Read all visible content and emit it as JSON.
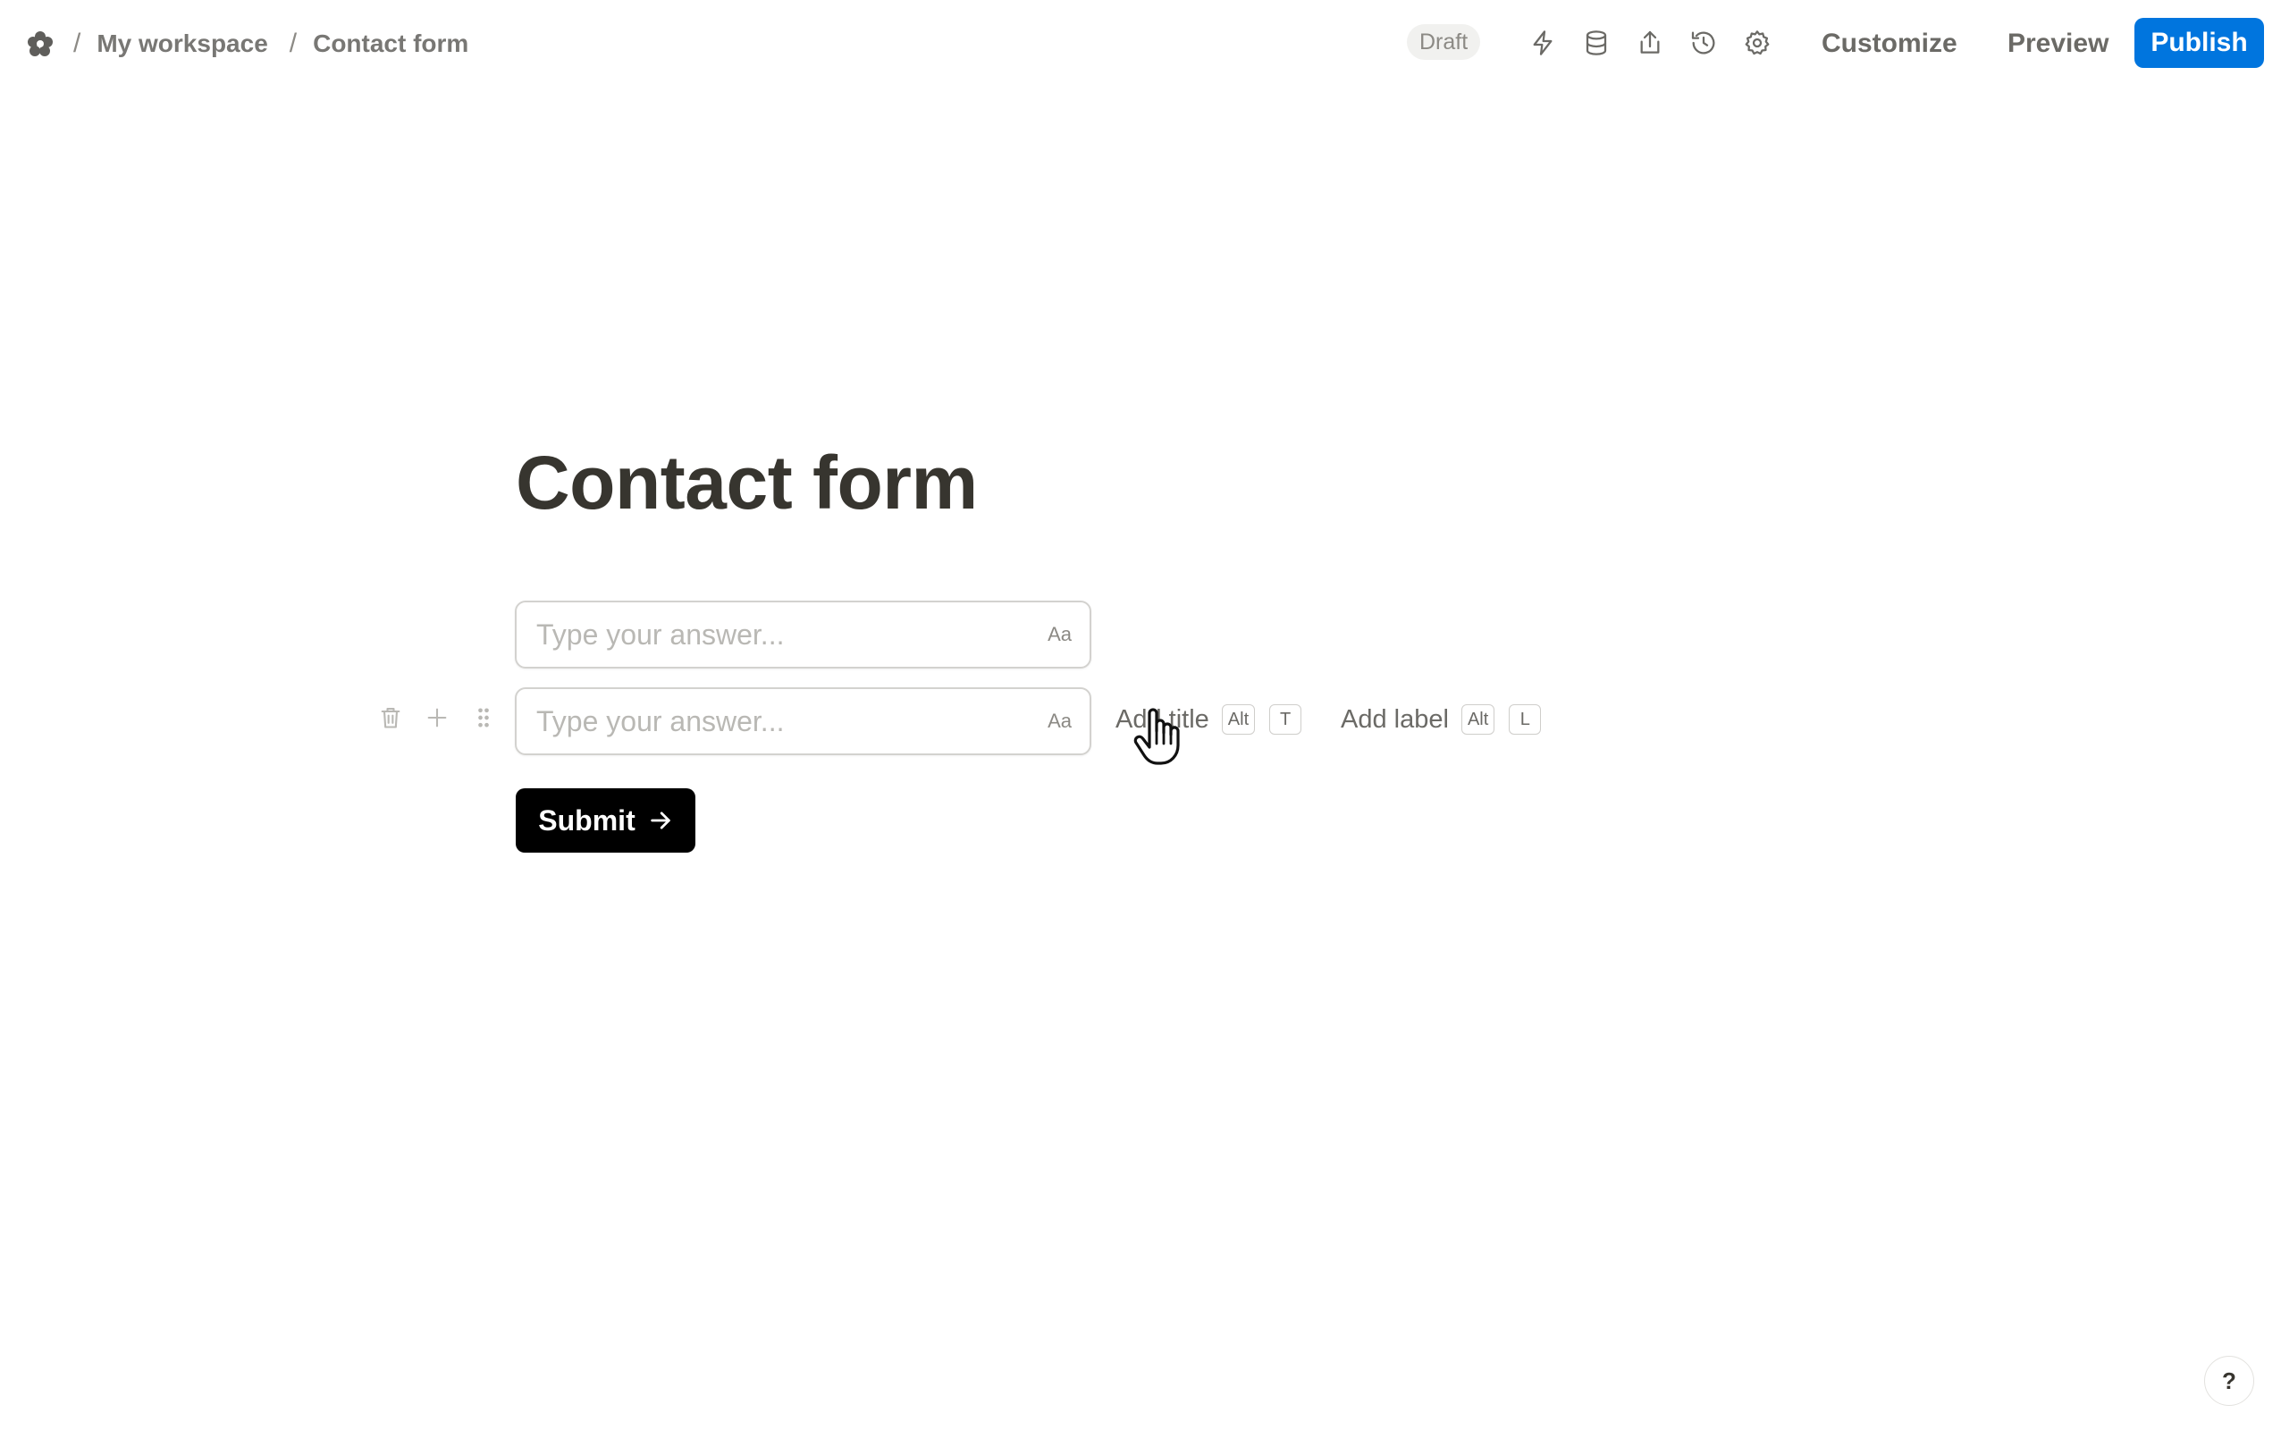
{
  "breadcrumb": {
    "separator": "/",
    "workspace": "My workspace",
    "page": "Contact form"
  },
  "header": {
    "status_badge": "Draft",
    "icons": [
      "lightning-icon",
      "database-icon",
      "share-icon",
      "history-icon",
      "gear-icon"
    ],
    "customize_label": "Customize",
    "preview_label": "Preview",
    "publish_label": "Publish",
    "publish_color": "#0075de"
  },
  "form": {
    "title": "Contact form",
    "fields": [
      {
        "placeholder": "Type your answer...",
        "type_hint": "Aa"
      },
      {
        "placeholder": "Type your answer...",
        "type_hint": "Aa"
      }
    ],
    "field_actions": {
      "add_title_label": "Add title",
      "add_title_keys": [
        "Alt",
        "T"
      ],
      "add_label_label": "Add label",
      "add_label_keys": [
        "Alt",
        "L"
      ]
    },
    "submit_label": "Submit"
  },
  "help": {
    "label": "?"
  }
}
